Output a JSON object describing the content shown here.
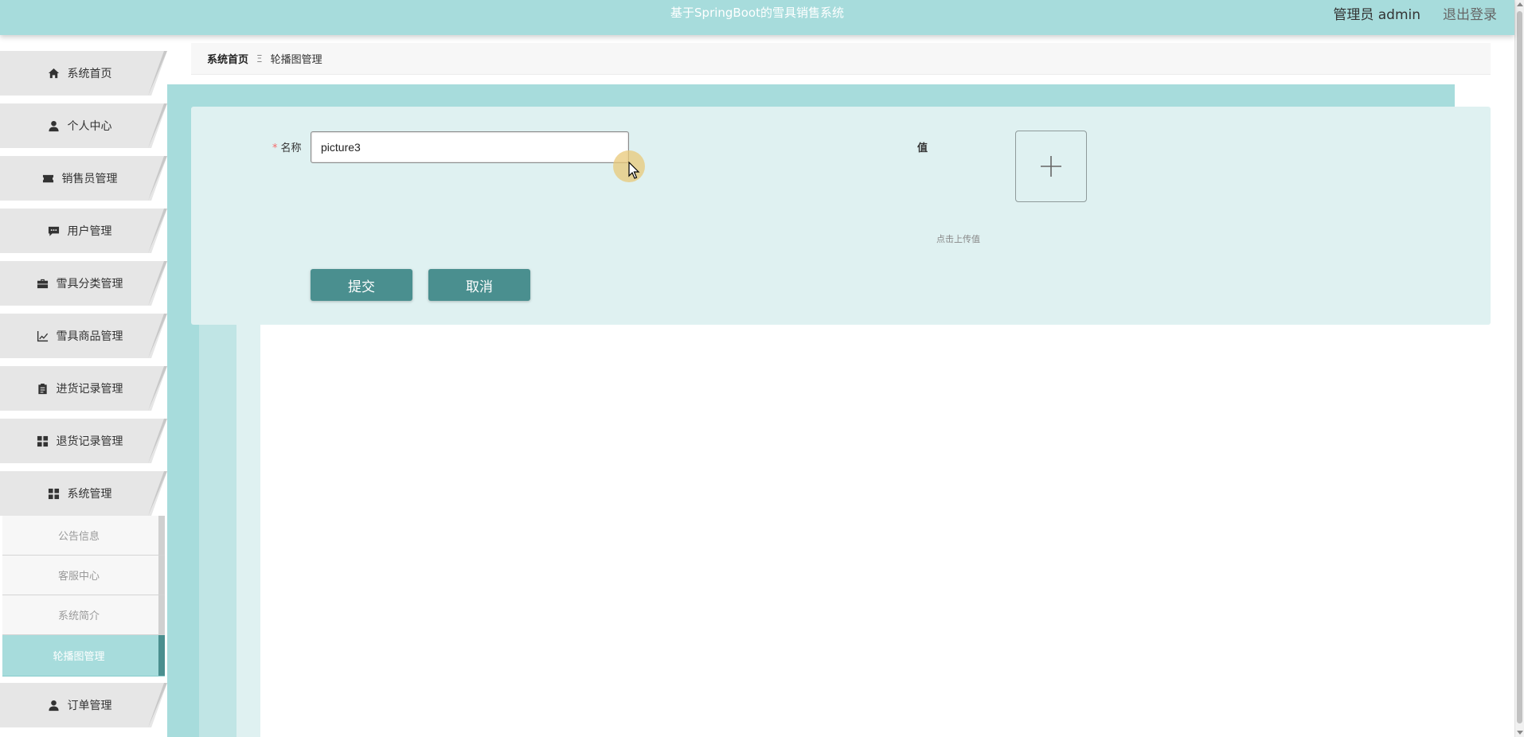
{
  "header": {
    "title": "基于SpringBoot的雪具销售系统",
    "user": "管理员 admin",
    "logout": "退出登录"
  },
  "breadcrumb": {
    "home": "系统首页",
    "separator": "Ξ",
    "current": "轮播图管理"
  },
  "sidebar": {
    "items": [
      {
        "label": "系统首页",
        "icon": "home-icon"
      },
      {
        "label": "个人中心",
        "icon": "user-icon"
      },
      {
        "label": "销售员管理",
        "icon": "ticket-icon"
      },
      {
        "label": "用户管理",
        "icon": "chat-icon"
      },
      {
        "label": "雪具分类管理",
        "icon": "briefcase-icon"
      },
      {
        "label": "雪具商品管理",
        "icon": "chart-icon"
      },
      {
        "label": "进货记录管理",
        "icon": "clipboard-icon"
      },
      {
        "label": "退货记录管理",
        "icon": "grid-icon"
      },
      {
        "label": "系统管理",
        "icon": "grid-icon"
      },
      {
        "label": "订单管理",
        "icon": "user-icon"
      }
    ],
    "submenu": [
      {
        "label": "公告信息"
      },
      {
        "label": "客服中心"
      },
      {
        "label": "系统简介"
      },
      {
        "label": "轮播图管理",
        "active": true
      }
    ]
  },
  "form": {
    "name_label": "名称",
    "name_value": "picture3",
    "value_label": "值",
    "upload_hint": "点击上传值",
    "submit_label": "提交",
    "cancel_label": "取消"
  },
  "colors": {
    "accent": "#a7dcdc",
    "button": "#4a8f8f",
    "panel": "#dff1f1",
    "required": "#f56c6c"
  }
}
